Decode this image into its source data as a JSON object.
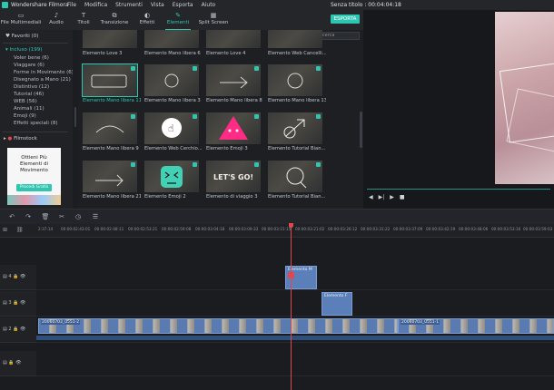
{
  "app": {
    "name": "Wondershare Filmora",
    "menu": [
      "File",
      "Modifica",
      "Strumenti",
      "Vista",
      "Esporta",
      "Aiuto"
    ],
    "project_title": "Senza titolo : 00:04:04:18"
  },
  "tabs": [
    {
      "label": "File Multimediali",
      "icon": "folder-icon"
    },
    {
      "label": "Audio",
      "icon": "music-note-icon"
    },
    {
      "label": "Titoli",
      "icon": "title-text-icon"
    },
    {
      "label": "Transizione",
      "icon": "transition-icon"
    },
    {
      "label": "Effetti",
      "icon": "effects-icon"
    },
    {
      "label": "Elementi",
      "icon": "elements-icon",
      "active": true
    },
    {
      "label": "Split Screen",
      "icon": "split-screen-icon"
    }
  ],
  "export_label": "ESPORTA",
  "sidebar": {
    "favorites": "Favoriti (0)",
    "included": "Incluso (199)",
    "items": [
      "Voler bene (6)",
      "Viaggare (6)",
      "Forme in Movimento (6)",
      "Disegnato a Mano (21)",
      "Distintivo (12)",
      "Tutorial (46)",
      "WEB (56)",
      "Animali (11)",
      "Emoji (9)",
      "Effetti speciali (8)"
    ],
    "filmstock": "Filmstock",
    "promo": {
      "lines": [
        "Ottieni Più",
        "Elementi di",
        "Movimento"
      ],
      "cta": "Procedi Gratis"
    }
  },
  "library": {
    "search_placeholder": "Ricerca",
    "tiles": [
      "Elemento Love 3",
      "Elemento Mano libera 6",
      "Elemento Love 4",
      "Elemento Web Cancelli...",
      "Elemento Mano libera 11",
      "Elemento Mano libera 3",
      "Elemento Mano libera 8",
      "Elemento Mano libera 13",
      "Elemento Mano libera 9",
      "Elemento Web Cerchio...",
      "Elemento Emoji 3",
      "Elemento Tutorial Bian...",
      "Elemento Mano libera 21",
      "Elemento Emoji 2",
      "Elemento di viaggio 3",
      "Elemento Tutorial Bian..."
    ],
    "selected_tile": "Elemento Mano libera 11"
  },
  "preview": {
    "controls": [
      "◀",
      "▶|",
      "▶",
      "■"
    ]
  },
  "ruler": {
    "ticks": [
      "2:37:14",
      "00:00:02:43:01",
      "00:00:02:48:11",
      "00:00:02:53:21",
      "00:00:02:59:08",
      "00:00:03:04:18",
      "00:00:03:09:33",
      "00:00:03:15:15",
      "00:00:03:21:02",
      "00:00:03:26:12",
      "00:00:03:31:22",
      "00:00:03:37:09",
      "00:00:03:42:19",
      "00:00:03:48:06",
      "00:00:03:53:16",
      "00:00:03:59:03"
    ]
  },
  "timeline": {
    "tracks": [
      {
        "id": "4",
        "clips": [
          {
            "label": "Elemento M"
          }
        ]
      },
      {
        "id": "3",
        "clips": [
          {
            "label": "Elemento F"
          }
        ]
      },
      {
        "id": "2",
        "clips": [
          {
            "label": "20060703_0551-2"
          },
          {
            "label": "20060703_0551-1"
          }
        ]
      },
      {
        "id": "1",
        "clips": []
      }
    ]
  },
  "colors": {
    "accent": "#2fc6b1",
    "playhead": "#e0484e",
    "clip": "#5b7fb8"
  }
}
